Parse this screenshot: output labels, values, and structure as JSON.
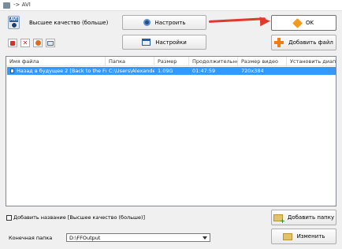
{
  "window": {
    "title": "-> AVI"
  },
  "profile": {
    "quality_label": "Высшее качество (больше)"
  },
  "buttons": {
    "configure": "Настроить",
    "settings": "Настройки",
    "ok": "OK",
    "add_file": "Добавить файл",
    "add_folder": "Добавить папку",
    "change": "Изменить"
  },
  "table": {
    "columns": [
      "Имя файла",
      "Папка",
      "Размер",
      "Продолжительность",
      "Размер видео",
      "Установить диапаз..."
    ],
    "rows": [
      {
        "name": "Назад в будущее 2 [Back to the Future 2...",
        "folder": "C:\\Users\\Alexander...",
        "size": "1.09G",
        "duration": "01:47:59",
        "video_size": "720x384",
        "range": ""
      }
    ]
  },
  "options": {
    "add_name_checkbox": "Добавить название [Высшее качество (больше)]",
    "add_name_checked": false
  },
  "destination": {
    "label": "Конечная папка",
    "value": "D:\\FFOutput"
  },
  "colors": {
    "selection": "#3399ff",
    "arrow": "#e03a2c",
    "ok_accent": "#f39a1d"
  }
}
